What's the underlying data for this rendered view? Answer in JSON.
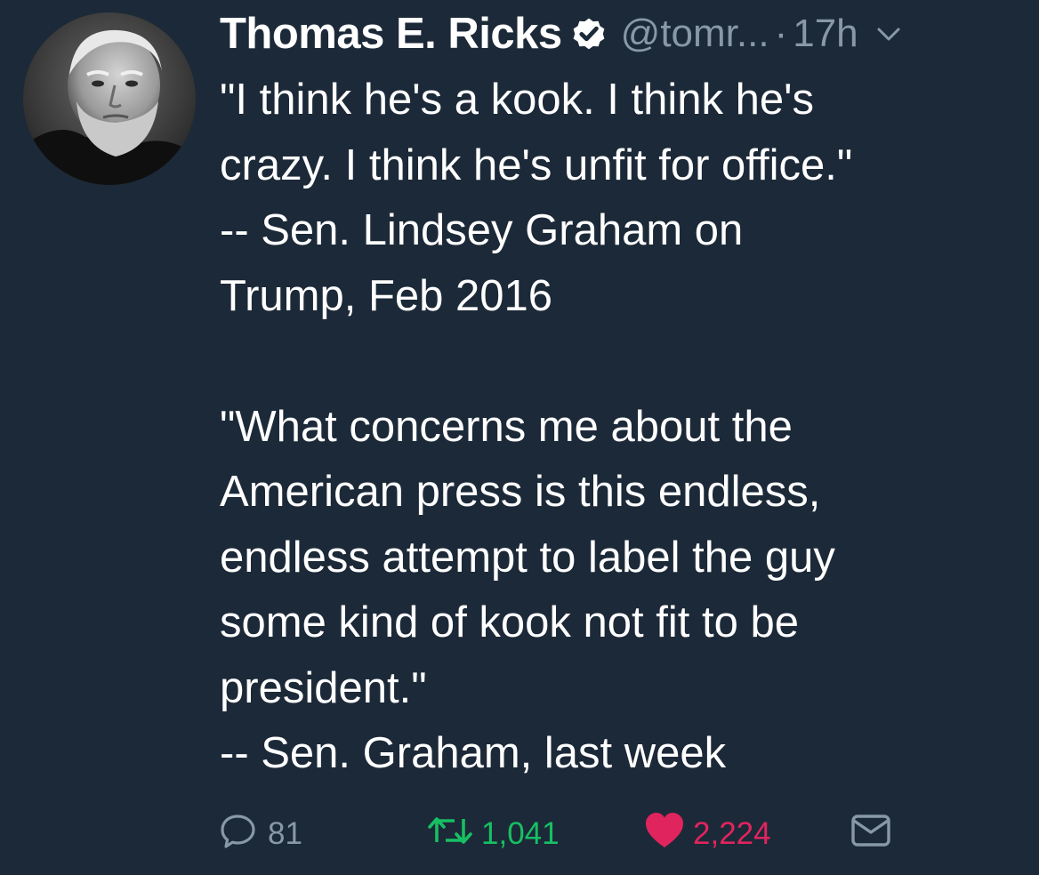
{
  "tweet": {
    "author": {
      "display_name": "Thomas E. Ricks",
      "handle": "@tomr...",
      "verified": true,
      "avatar_icon": "profile-photo"
    },
    "separator": "·",
    "timestamp": "17h",
    "text": "\"I think he's a kook. I think he's\ncrazy. I think he's unfit for office.\"\n-- Sen. Lindsey Graham on\nTrump, Feb 2016\n\n\"What concerns me about the\nAmerican press is this endless,\nendless attempt to label the guy\nsome kind of kook not fit to be\npresident.\"\n-- Sen. Graham, last week",
    "actions": {
      "reply_count": "81",
      "retweet_count": "1,041",
      "like_count": "2,224"
    }
  },
  "icons": {
    "verified": "verified-badge-icon",
    "caret": "chevron-down-icon",
    "reply": "reply-bubble-icon",
    "retweet": "retweet-icon",
    "like": "heart-icon",
    "message": "envelope-icon"
  },
  "colors": {
    "background": "#1c2938",
    "primary_text": "#ffffff",
    "secondary_text": "#8899a6",
    "retweet_green": "#17bf63",
    "like_red": "#e0245e"
  }
}
